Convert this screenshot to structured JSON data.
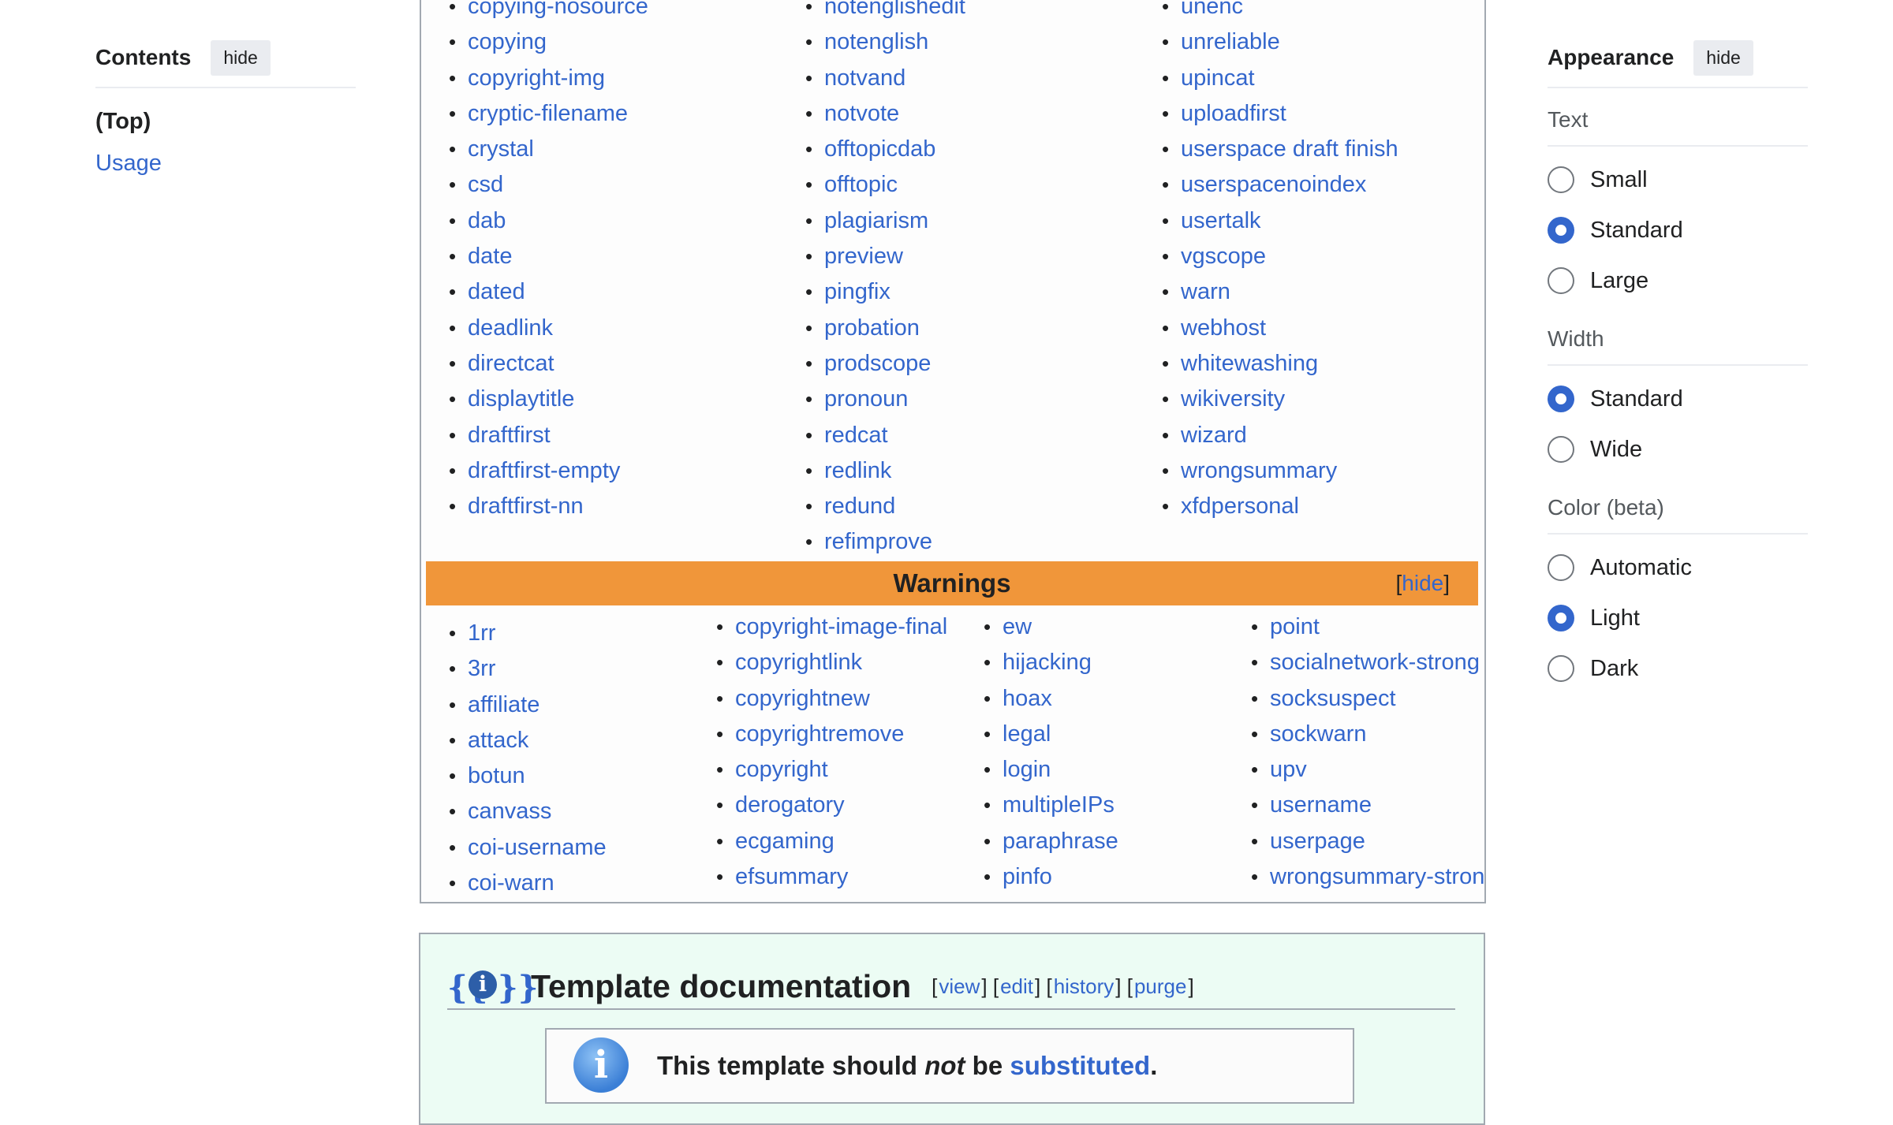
{
  "toc": {
    "title": "Contents",
    "hide_label": "hide",
    "top_label": "(Top)",
    "usage_label": "Usage"
  },
  "navbox": {
    "col1": [
      "copying-nosource",
      "copying",
      "copyright-img",
      "cryptic-filename",
      "crystal",
      "csd",
      "dab",
      "date",
      "dated",
      "deadlink",
      "directcat",
      "displaytitle",
      "draftfirst",
      "draftfirst-empty",
      "draftfirst-nn"
    ],
    "col2": [
      "notenglishedit",
      "notenglish",
      "notvand",
      "notvote",
      "offtopicdab",
      "offtopic",
      "plagiarism",
      "preview",
      "pingfix",
      "probation",
      "prodscope",
      "pronoun",
      "redcat",
      "redlink",
      "redund",
      "refimprove"
    ],
    "col3": [
      "unenc",
      "unreliable",
      "upincat",
      "uploadfirst",
      "userspace draft finish",
      "userspacenoindex",
      "usertalk",
      "vgscope",
      "warn",
      "webhost",
      "whitewashing",
      "wikiversity",
      "wizard",
      "wrongsummary",
      "xfdpersonal"
    ],
    "warnings_title": "Warnings",
    "warnings_hide": "hide",
    "wcol1": [
      "1rr",
      "3rr",
      "affiliate",
      "attack",
      "botun",
      "canvass",
      "coi-username",
      "coi-warn"
    ],
    "wcol2": [
      "copyright-image-final",
      "copyrightlink",
      "copyrightnew",
      "copyrightremove",
      "copyright",
      "derogatory",
      "ecgaming",
      "efsummary"
    ],
    "wcol3": [
      "ew",
      "hijacking",
      "hoax",
      "legal",
      "login",
      "multipleIPs",
      "paraphrase",
      "pinfo"
    ],
    "wcol4": [
      "point",
      "socialnetwork-strong",
      "socksuspect",
      "sockwarn",
      "upv",
      "username",
      "userpage",
      "wrongsummary-strong"
    ]
  },
  "doc": {
    "title": "Template documentation",
    "links": [
      "view",
      "edit",
      "history",
      "purge"
    ],
    "notice_prefix": "This template should ",
    "notice_emph": "not",
    "notice_mid": " be ",
    "notice_link": "substituted",
    "notice_suffix": "."
  },
  "appearance": {
    "title": "Appearance",
    "hide_label": "hide",
    "text_label": "Text",
    "text_options": [
      "Small",
      "Standard",
      "Large"
    ],
    "text_selected": "Standard",
    "width_label": "Width",
    "width_options": [
      "Standard",
      "Wide"
    ],
    "width_selected": "Standard",
    "color_label": "Color (beta)",
    "color_options": [
      "Automatic",
      "Light",
      "Dark"
    ],
    "color_selected": "Light"
  },
  "colors": {
    "link": "#3366cc",
    "warnings_bar": "#f0963a",
    "doc_background": "#ecfcf4",
    "radio_checked": "#3366cc"
  }
}
